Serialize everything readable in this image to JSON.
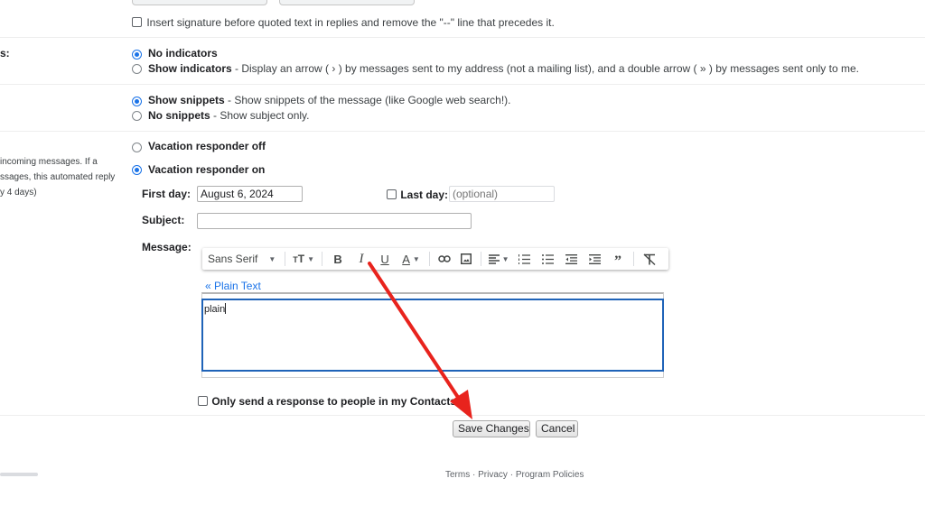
{
  "signature": {
    "insert_before_quoted": "Insert signature before quoted text in replies and remove the \"--\" line that precedes it.",
    "checked": false
  },
  "indicators": {
    "section_label_fragment": "s:",
    "options": [
      {
        "title": "No indicators",
        "desc": "",
        "selected": true
      },
      {
        "title": "Show indicators",
        "desc": " - Display an arrow ( › ) by messages sent to my address (not a mailing list), and a double arrow ( » ) by messages sent only to me.",
        "selected": false
      }
    ]
  },
  "snippets": {
    "options": [
      {
        "title": "Show snippets",
        "desc": " - Show snippets of the message (like Google web search!).",
        "selected": true
      },
      {
        "title": "No snippets",
        "desc": " - Show subject only.",
        "selected": false
      }
    ]
  },
  "vacation": {
    "left_description": [
      "incoming messages. If a",
      "ssages, this automated reply",
      "y 4 days)"
    ],
    "options": [
      {
        "title": "Vacation responder off",
        "selected": false
      },
      {
        "title": "Vacation responder on",
        "selected": true
      }
    ],
    "first_day_label": "First day:",
    "first_day_value": "August 6, 2024",
    "last_day_label": "Last day:",
    "last_day_checked": false,
    "last_day_placeholder": "(optional)",
    "subject_label": "Subject:",
    "subject_value": "",
    "message_label": "Message:",
    "toolbar": {
      "font_name": "Sans Serif",
      "items": [
        "font-family",
        "font-size",
        "bold",
        "italic",
        "underline",
        "text-color",
        "link",
        "image",
        "align",
        "numbered-list",
        "bulleted-list",
        "indent-less",
        "indent-more",
        "quote",
        "remove-formatting"
      ]
    },
    "plain_text_link": "« Plain Text",
    "message_body": "plain",
    "contacts_only_label": "Only send a response to people in my Contacts",
    "contacts_only_checked": false
  },
  "actions": {
    "save": "Save Changes",
    "cancel": "Cancel"
  },
  "annotation": {
    "arrow_color": "#e8231d",
    "points_to": "Save Changes"
  },
  "footer": {
    "links": [
      "Terms",
      "Privacy",
      "Program Policies"
    ],
    "separator": " · "
  }
}
